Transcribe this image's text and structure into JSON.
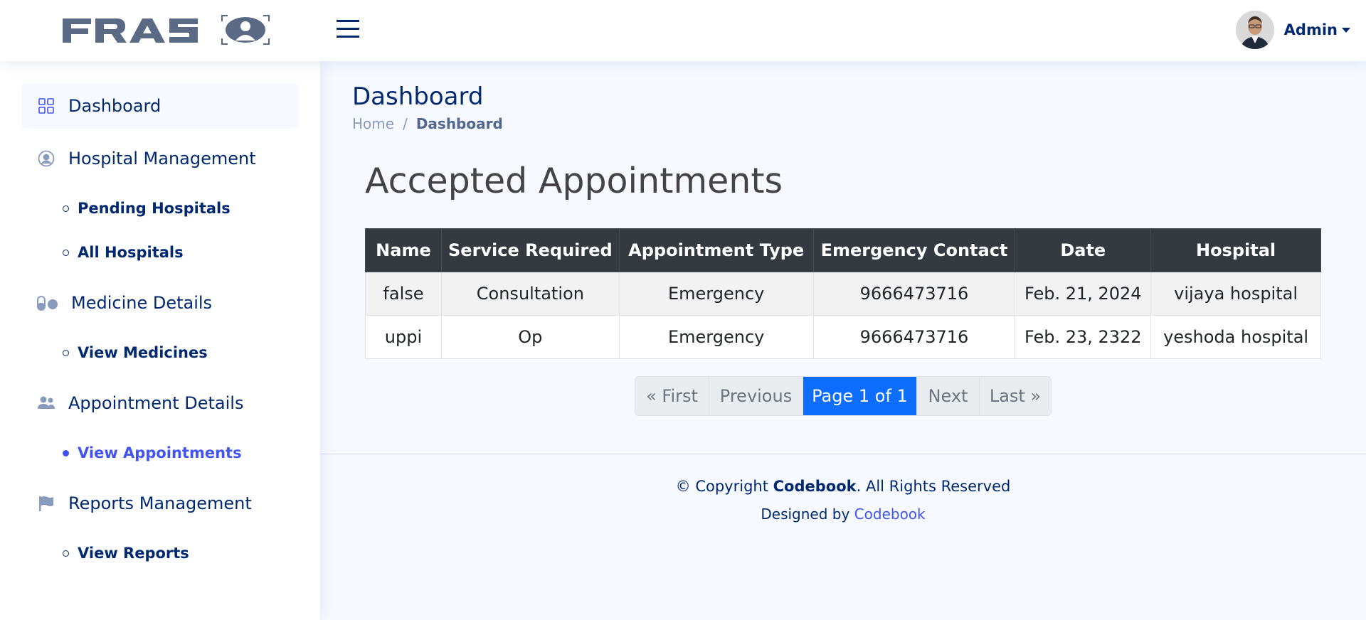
{
  "header": {
    "logo_text": "FRAS",
    "user_name": "Admin"
  },
  "sidebar": {
    "items": [
      {
        "label": "Dashboard",
        "icon": "grid-icon"
      },
      {
        "label": "Hospital Management",
        "icon": "person-circle-icon"
      },
      {
        "label": "Pending Hospitals"
      },
      {
        "label": "All Hospitals"
      },
      {
        "label": "Medicine Details",
        "icon": "capsule-icon"
      },
      {
        "label": "View Medicines"
      },
      {
        "label": "Appointment Details",
        "icon": "people-icon"
      },
      {
        "label": "View Appointments"
      },
      {
        "label": "Reports Management",
        "icon": "flag-icon"
      },
      {
        "label": "View Reports"
      }
    ]
  },
  "page": {
    "title": "Dashboard",
    "breadcrumb": {
      "home": "Home",
      "separator": "/",
      "current": "Dashboard"
    }
  },
  "section": {
    "title": "Accepted Appointments"
  },
  "table": {
    "headers": [
      "Name",
      "Service Required",
      "Appointment Type",
      "Emergency Contact",
      "Date",
      "Hospital"
    ],
    "rows": [
      [
        "false",
        "Consultation",
        "Emergency",
        "9666473716",
        "Feb. 21, 2024",
        "vijaya hospital"
      ],
      [
        "uppi",
        "Op",
        "Emergency",
        "9666473716",
        "Feb. 23, 2322",
        "yeshoda hospital"
      ]
    ]
  },
  "pagination": {
    "first": "« First",
    "previous": "Previous",
    "current": "Page 1 of 1",
    "next": "Next",
    "last": "Last »"
  },
  "footer": {
    "copyright_prefix": "© Copyright",
    "brand": "Codebook",
    "copyright_suffix": ". All Rights Reserved",
    "designed_by": "Designed by",
    "designer": "Codebook"
  },
  "colors": {
    "primary": "#012970",
    "accent": "#4154f1",
    "table_header": "#343a40",
    "pager_active": "#0d6efd"
  }
}
